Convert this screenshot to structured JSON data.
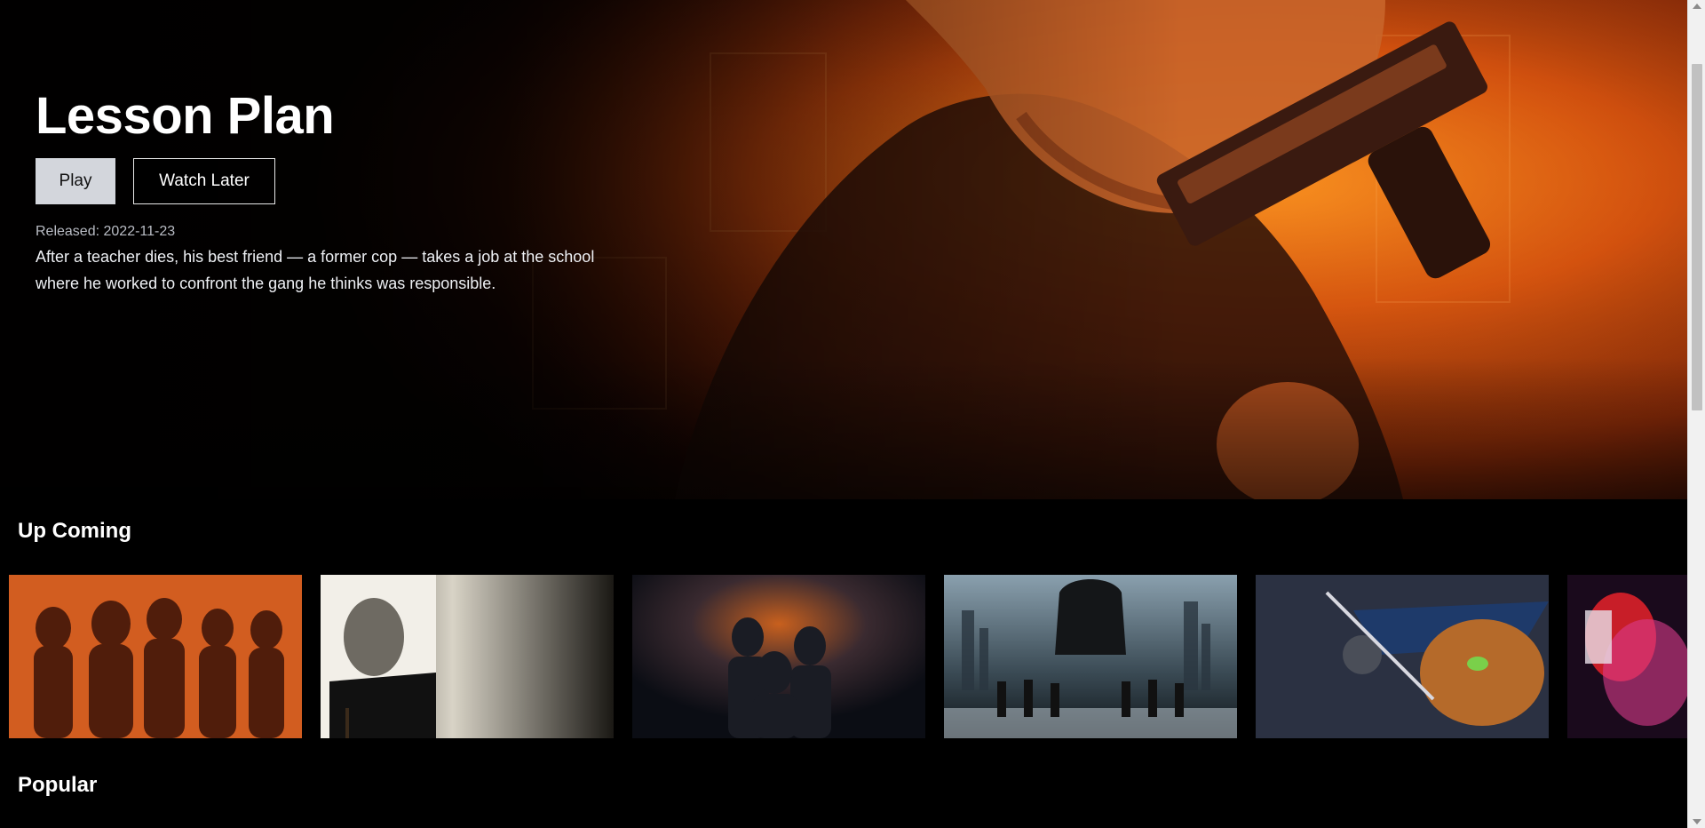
{
  "hero": {
    "title": "Lesson Plan",
    "play_label": "Play",
    "watch_later_label": "Watch Later",
    "released": "Released: 2022-11-23",
    "overview": "After a teacher dies, his best friend — a former cop — takes a job at the school where he worked to confront the gang he thinks was responsible."
  },
  "sections": {
    "upcoming_title": "Up Coming",
    "popular_title": "Popular"
  },
  "upcoming_cards": [
    {
      "name": "upcoming-card-1",
      "palette": [
        "#f07a2a",
        "#c4481a",
        "#6b2212"
      ]
    },
    {
      "name": "upcoming-card-2",
      "palette": [
        "#d7d2c6",
        "#8c8678",
        "#1a1814"
      ]
    },
    {
      "name": "upcoming-card-3",
      "palette": [
        "#1a2030",
        "#c85a20",
        "#0b0d14"
      ]
    },
    {
      "name": "upcoming-card-4",
      "palette": [
        "#6f8595",
        "#2e3a44",
        "#0e1418"
      ]
    },
    {
      "name": "upcoming-card-5",
      "palette": [
        "#2a3040",
        "#c9782a",
        "#12141c"
      ]
    },
    {
      "name": "upcoming-card-6",
      "palette": [
        "#3a1030",
        "#c8202a",
        "#1a0818"
      ]
    }
  ]
}
